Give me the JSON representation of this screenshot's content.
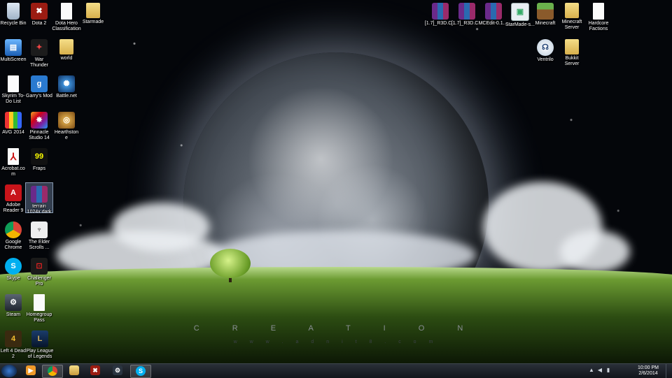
{
  "wallpaper": {
    "title": "C R E A T I O N",
    "subtitle": "w w w . a d n i t 8 . c o m"
  },
  "icons_left": [
    {
      "label": "Recycle Bin",
      "icon": "recycle-bin-icon"
    },
    {
      "label": "Dota 2",
      "icon": "dota2-icon"
    },
    {
      "label": "Dota Hero Classification",
      "icon": "document-icon"
    },
    {
      "label": "Starmade",
      "icon": "folder-icon"
    },
    {
      "label": "MultiScreen",
      "icon": "multiscreen-icon"
    },
    {
      "label": "War Thunder",
      "icon": "war-thunder-icon"
    },
    {
      "label": "world",
      "icon": "folder-icon"
    },
    {
      "label": "Skyrim To-Do List",
      "icon": "document-icon"
    },
    {
      "label": "Garry's Mod",
      "icon": "garrys-mod-icon"
    },
    {
      "label": "Battle.net",
      "icon": "battlenet-icon"
    },
    {
      "label": "AVG 2014",
      "icon": "avg-icon"
    },
    {
      "label": "Pinnacle Studio 14",
      "icon": "pinnacle-icon"
    },
    {
      "label": "Hearthstone",
      "icon": "hearthstone-icon"
    },
    {
      "label": "Acrobat.com",
      "icon": "acrobat-icon"
    },
    {
      "label": "Fraps",
      "icon": "fraps-icon"
    },
    {
      "label": "Adobe Reader 9",
      "icon": "adobe-reader-icon"
    },
    {
      "label": "terrain 1024x dark",
      "icon": "winrar-archive-icon"
    },
    {
      "label": "Google Chrome",
      "icon": "chrome-icon"
    },
    {
      "label": "The Elder Scrolls ...",
      "icon": "elder-scrolls-icon"
    },
    {
      "label": "Skype",
      "icon": "skype-icon"
    },
    {
      "label": "Challenger Pro",
      "icon": "challenger-icon"
    },
    {
      "label": "Steam",
      "icon": "steam-icon"
    },
    {
      "label": "Homegroup Pass",
      "icon": "document-icon"
    },
    {
      "label": "Left 4 Dead 2",
      "icon": "left4dead-icon"
    },
    {
      "label": "Play League of Legends",
      "icon": "league-icon"
    }
  ],
  "icons_right": [
    {
      "label": "[1.7]_R3D.C...",
      "icon": "winrar-archive-icon"
    },
    {
      "label": "[1.7]_R3D.C...",
      "icon": "winrar-archive-icon"
    },
    {
      "label": "MCEdit-0.1....",
      "icon": "winrar-archive-icon"
    },
    {
      "label": "StarMade-s...",
      "icon": "application-icon"
    },
    {
      "label": "Minecraft",
      "icon": "minecraft-icon"
    },
    {
      "label": "Minecraft Server",
      "icon": "folder-icon"
    },
    {
      "label": "Hardcore Factions",
      "icon": "document-icon"
    },
    {
      "label": "Ventrilo",
      "icon": "ventrilo-icon"
    },
    {
      "label": "Bukkit Server",
      "icon": "folder-icon"
    }
  ],
  "taskbar": {
    "pinned": [
      {
        "icon": "media-player-icon"
      },
      {
        "icon": "chrome-icon",
        "active": true
      },
      {
        "icon": "explorer-icon"
      },
      {
        "icon": "dota2-icon"
      },
      {
        "icon": "steam-icon"
      },
      {
        "icon": "skype-icon"
      }
    ],
    "tray": {
      "time": "10:00 PM",
      "date": "2/6/2014"
    }
  }
}
